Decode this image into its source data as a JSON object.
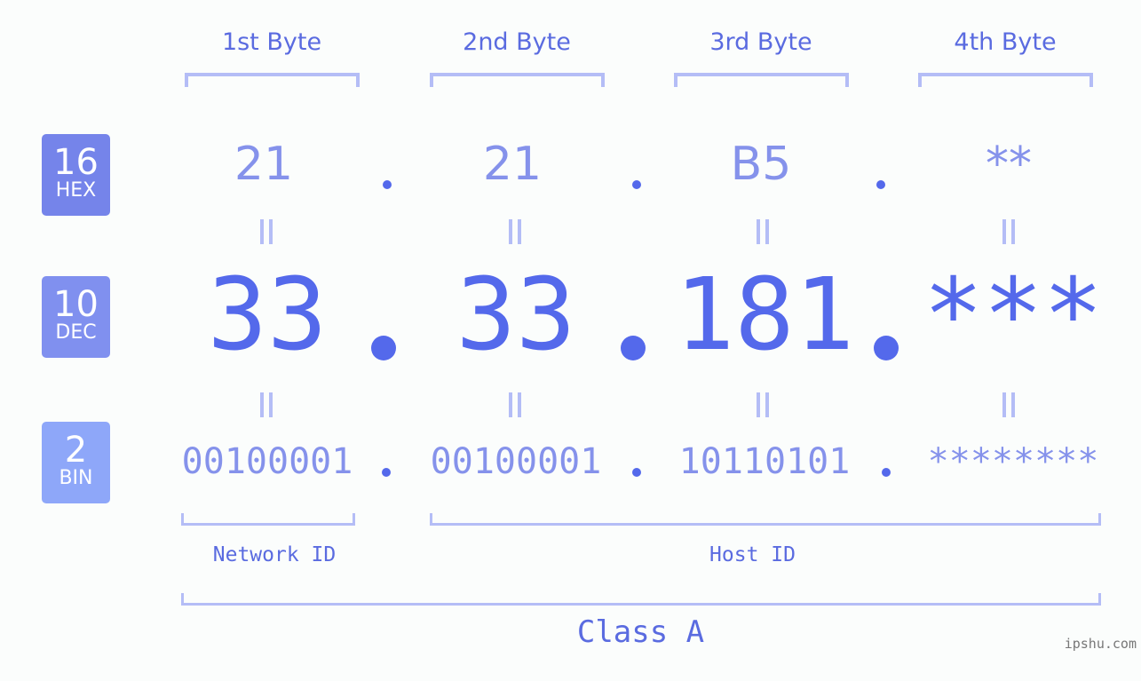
{
  "byte_headers": [
    "1st Byte",
    "2nd Byte",
    "3rd Byte",
    "4th Byte"
  ],
  "badges": {
    "hex": {
      "number": "16",
      "label": "HEX",
      "color": "#7584ea"
    },
    "dec": {
      "number": "10",
      "label": "DEC",
      "color": "#8090ef"
    },
    "bin": {
      "number": "2",
      "label": "BIN",
      "color": "#8ea7f9"
    }
  },
  "hex_values": [
    "21",
    "21",
    "B5",
    "**"
  ],
  "dec_values": [
    "33",
    "33",
    "181",
    "***"
  ],
  "bin_values": [
    "00100001",
    "00100001",
    "10110101",
    "********"
  ],
  "network_id_label": "Network ID",
  "host_id_label": "Host ID",
  "class_label": "Class A",
  "watermark": "ipshu.com",
  "colors": {
    "accent": "#5469eb",
    "light_accent": "#8592eb",
    "bracket": "#b4bdf6",
    "background": "#fbfdfc"
  }
}
